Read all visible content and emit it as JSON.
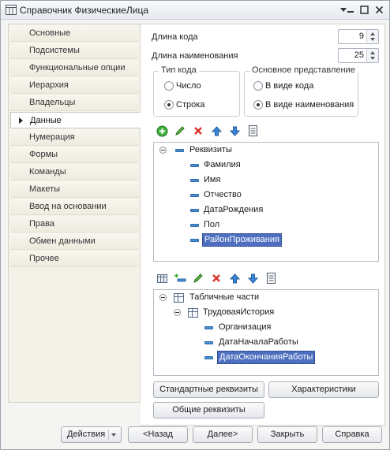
{
  "window": {
    "title": "Справочник ФизическиеЛица"
  },
  "nav": {
    "items": [
      {
        "label": "Основные"
      },
      {
        "label": "Подсистемы"
      },
      {
        "label": "Функциональные опции"
      },
      {
        "label": "Иерархия"
      },
      {
        "label": "Владельцы"
      },
      {
        "label": "Данные",
        "active": true
      },
      {
        "label": "Нумерация"
      },
      {
        "label": "Формы"
      },
      {
        "label": "Команды"
      },
      {
        "label": "Макеты"
      },
      {
        "label": "Ввод на основании"
      },
      {
        "label": "Права"
      },
      {
        "label": "Обмен данными"
      },
      {
        "label": "Прочее"
      }
    ]
  },
  "data_tab": {
    "code_length_label": "Длина кода",
    "code_length_value": "9",
    "name_length_label": "Длина наименования",
    "name_length_value": "25",
    "code_type": {
      "title": "Тип кода",
      "options": [
        "Число",
        "Строка"
      ],
      "selected": "Строка"
    },
    "main_presentation": {
      "title": "Основное представление",
      "options": [
        "В виде кода",
        "В виде наименования"
      ],
      "selected": "В виде наименования"
    },
    "attributes": {
      "root": "Реквизиты",
      "items": [
        "Фамилия",
        "Имя",
        "Отчество",
        "ДатаРождения",
        "Пол",
        "РайонПроживания"
      ],
      "selected": "РайонПроживания"
    },
    "tabular_sections": {
      "root": "Табличные части",
      "section": "ТрудоваяИстория",
      "items": [
        "Организация",
        "ДатаНачалаРаботы",
        "ДатаОкончанияРаботы"
      ],
      "selected": "ДатаОкончанияРаботы"
    },
    "buttons": {
      "standard_attributes": "Стандартные реквизиты",
      "characteristics": "Характеристики",
      "common_attributes": "Общие реквизиты"
    }
  },
  "footer": {
    "actions": "Действия",
    "back": "<Назад",
    "next": "Далее>",
    "close": "Закрыть",
    "help": "Справка"
  }
}
